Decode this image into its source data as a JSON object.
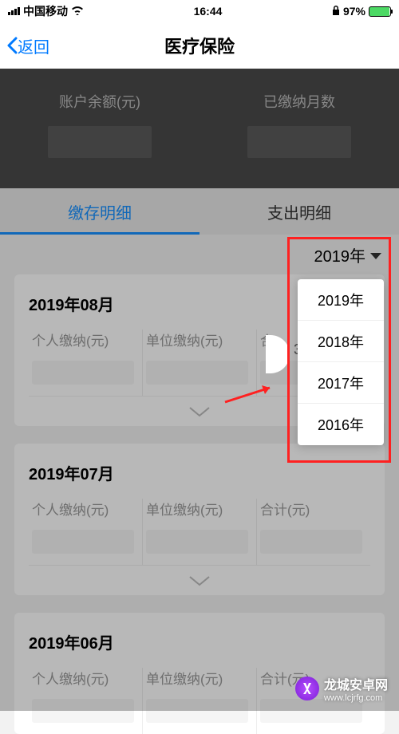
{
  "status": {
    "carrier": "中国移动",
    "time": "16:44",
    "battery_pct": "97%"
  },
  "nav": {
    "back_label": "返回",
    "title": "医疗保险"
  },
  "summary": {
    "balance_label": "账户余额(元)",
    "months_label": "已缴纳月数"
  },
  "tabs": {
    "deposit": "缴存明细",
    "expense": "支出明细"
  },
  "year_selector": {
    "current": "2019年"
  },
  "dropdown": {
    "options": [
      "2019年",
      "2018年",
      "2017年",
      "2016年"
    ]
  },
  "records": [
    {
      "month": "2019年08月",
      "personal_label": "个人缴纳(元)",
      "company_label": "单位缴纳(元)",
      "total_label": "合"
    },
    {
      "month": "2019年07月",
      "personal_label": "个人缴纳(元)",
      "company_label": "单位缴纳(元)",
      "total_label": "合计(元)"
    },
    {
      "month": "2019年06月",
      "personal_label": "个人缴纳(元)",
      "company_label": "单位缴纳(元)",
      "total_label": "合计(元)"
    }
  ],
  "watermark": {
    "name": "龙城安卓网",
    "url": "www.lcjrfg.com"
  }
}
